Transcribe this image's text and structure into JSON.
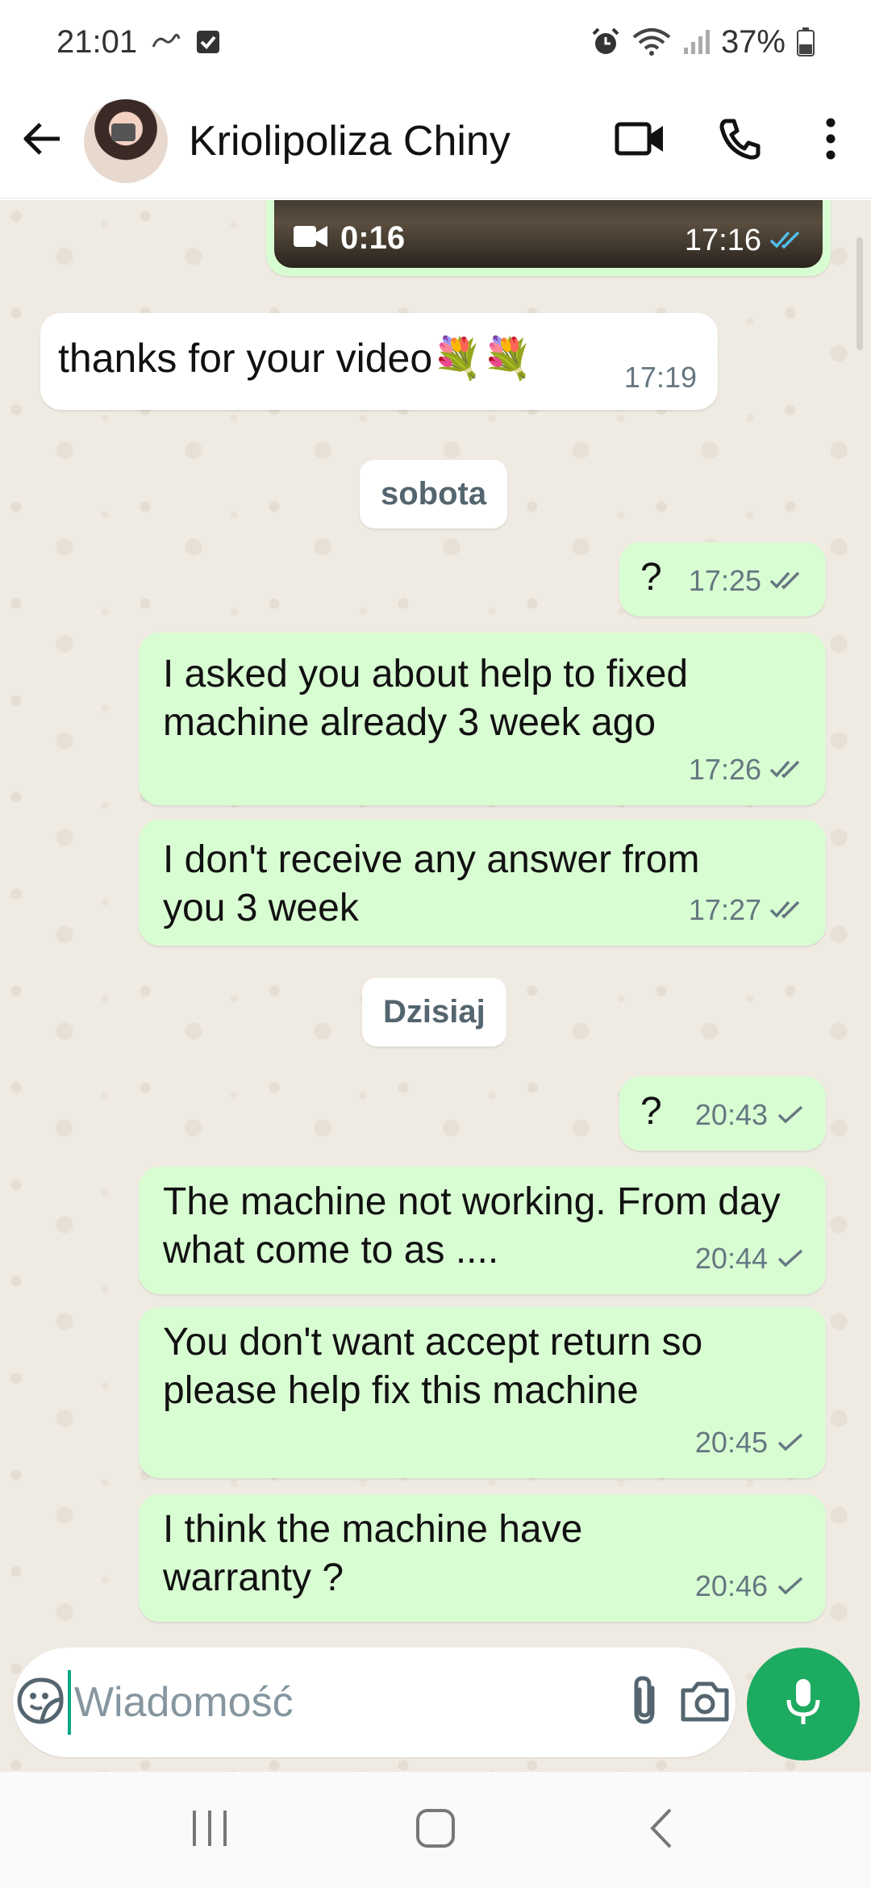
{
  "status_bar": {
    "time": "21:01",
    "battery": "37%",
    "icons": [
      "link-icon",
      "checkbox-icon",
      "alarm-icon",
      "wifi-icon",
      "signal-icon",
      "battery-icon"
    ]
  },
  "header": {
    "contact_name": "Kriolipoliza Chiny",
    "icons": [
      "back-arrow-icon",
      "video-call-icon",
      "phone-icon",
      "more-vert-icon"
    ]
  },
  "chat": {
    "video_message": {
      "duration": "0:16",
      "time": "17:16",
      "status": "read"
    },
    "messages": [
      {
        "direction": "in",
        "text": "thanks for your video",
        "emoji": "💐💐",
        "time": "17:19"
      },
      {
        "type": "date",
        "label": "sobota"
      },
      {
        "direction": "out",
        "text": "?",
        "time": "17:25",
        "status": "delivered"
      },
      {
        "direction": "out",
        "text": "I asked  you about help to fixed machine already 3 week ago",
        "time": "17:26",
        "status": "delivered"
      },
      {
        "direction": "out",
        "text": "I don't receive any answer from you 3 week",
        "time": "17:27",
        "status": "delivered"
      },
      {
        "type": "date",
        "label": "Dzisiaj"
      },
      {
        "direction": "out",
        "text": "?",
        "time": "20:43",
        "status": "sent"
      },
      {
        "direction": "out",
        "text": "The machine not working.  From day what come to as ....",
        "time": "20:44",
        "status": "sent"
      },
      {
        "direction": "out",
        "text": "You don't want accept return so please help fix this machine",
        "time": "20:45",
        "status": "sent"
      },
      {
        "direction": "out",
        "text": "I think the machine have warranty ?",
        "time": "20:46",
        "status": "sent"
      }
    ]
  },
  "composer": {
    "placeholder": "Wiadomość",
    "icons": [
      "sticker-icon",
      "attach-icon",
      "camera-icon",
      "mic-icon"
    ]
  },
  "nav": {
    "icons": [
      "recents-icon",
      "home-icon",
      "back-icon"
    ]
  },
  "colors": {
    "outgoing_bubble": "#d9fdd3",
    "incoming_bubble": "#ffffff",
    "chat_bg": "#efeae2",
    "accent": "#1daa61",
    "read_tick": "#53bdeb",
    "meta_text": "#667781"
  }
}
